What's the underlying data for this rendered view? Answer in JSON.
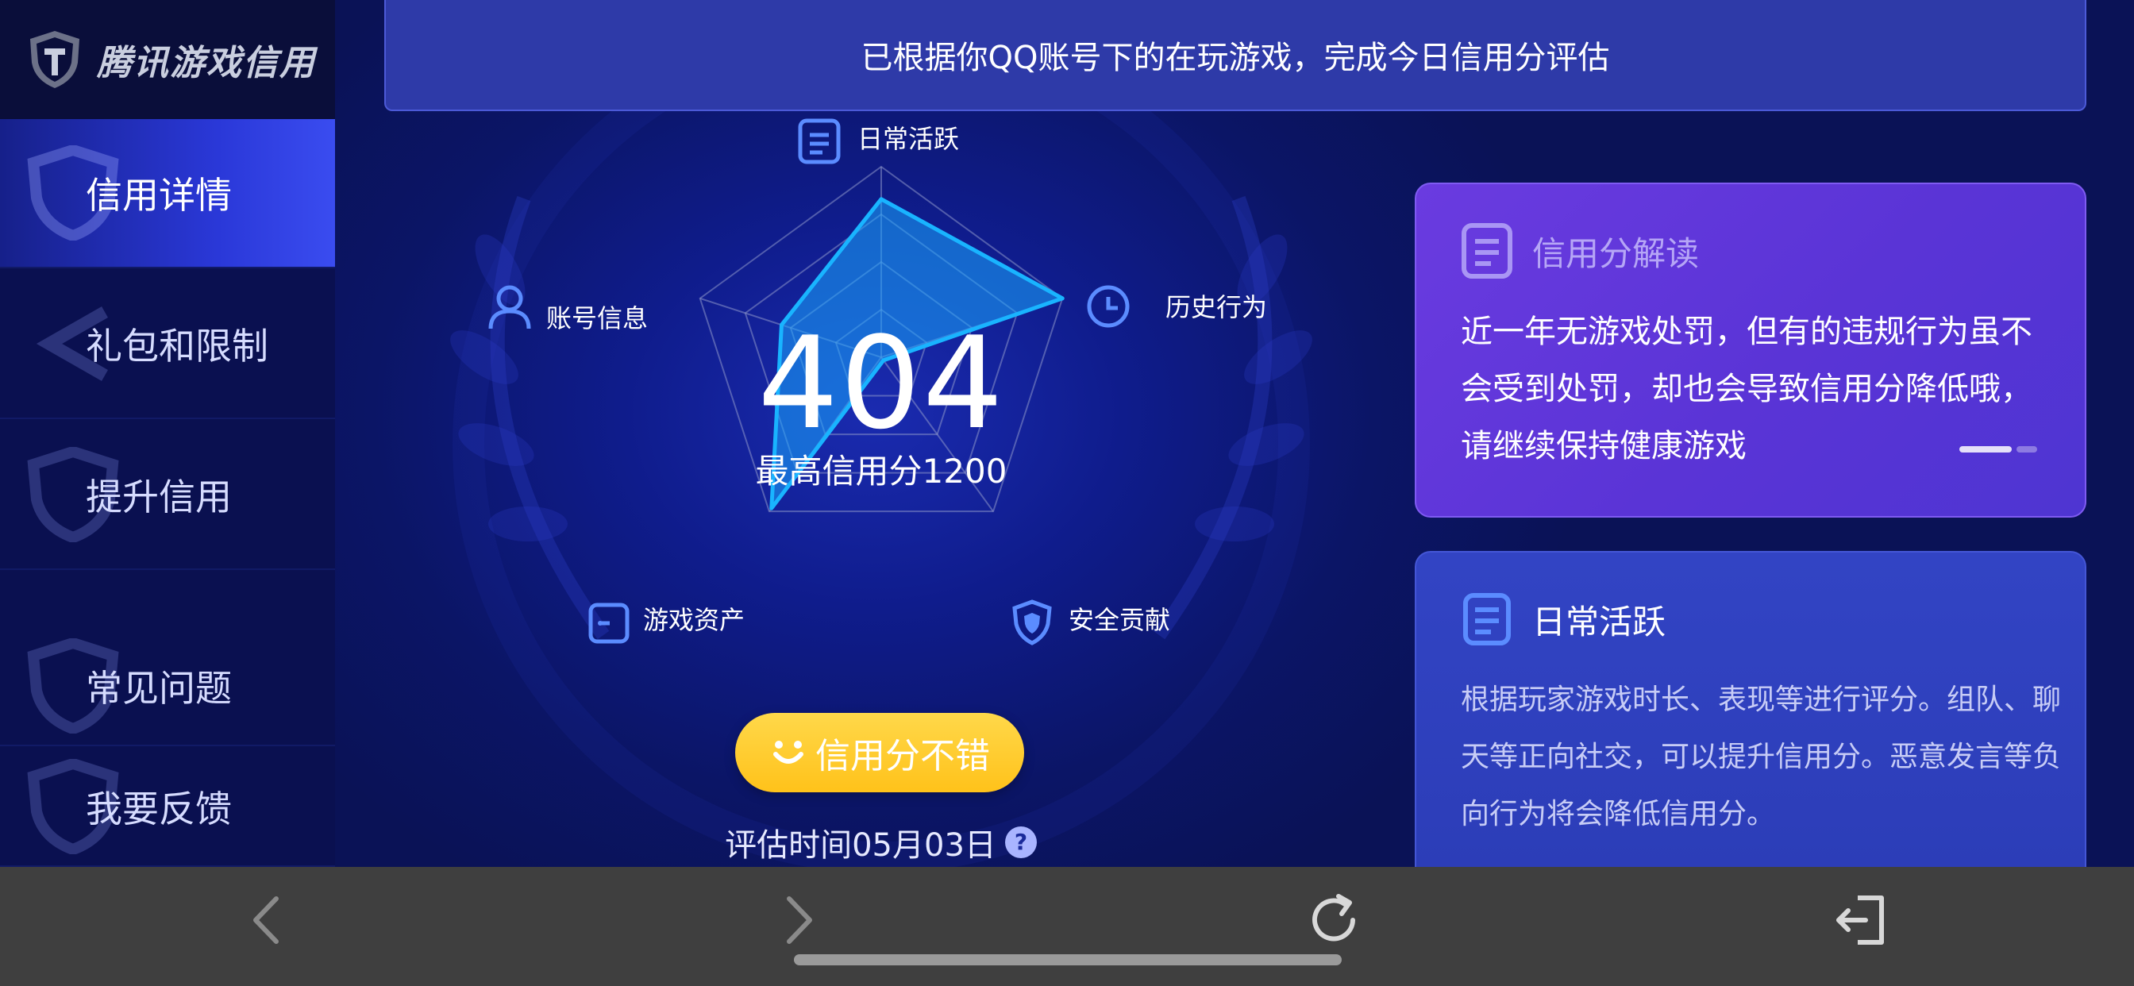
{
  "sidebar": {
    "logo_text": "腾讯游戏信用",
    "items": [
      {
        "label": "信用详情",
        "active": true
      },
      {
        "label": "礼包和限制",
        "active": false
      },
      {
        "label": "提升信用",
        "active": false
      },
      {
        "label": "常见问题",
        "active": false
      },
      {
        "label": "我要反馈",
        "active": false
      }
    ]
  },
  "banner": {
    "text": "已根据你QQ账号下的在玩游戏，完成今日信用分评估"
  },
  "radar": {
    "labels": {
      "daily": "日常活跃",
      "history": "历史行为",
      "security": "安全贡献",
      "assets": "游戏资产",
      "account": "账号信息"
    },
    "levels": {
      "daily": 0.83,
      "history": 1.0,
      "security": 0.02,
      "assets": 0.98,
      "account": 0.55
    }
  },
  "score": {
    "value": "404",
    "max_text": "最高信用分1200"
  },
  "status_pill": {
    "label": "信用分不错"
  },
  "eval_time": {
    "text": "评估时间05月03日"
  },
  "cards": {
    "interpret": {
      "title": "信用分解读",
      "body": "近一年无游戏处罚，但有的违规行为虽不会受到处罚，却也会导致信用分降低哦，请继续保持健康游戏"
    },
    "daily": {
      "title": "日常活跃",
      "body": "根据玩家游戏时长、表现等进行评分。组队、聊天等正向社交，可以提升信用分。恶意发言等负向行为将会降低信用分。"
    }
  },
  "colors": {
    "accent_cyan": "#1ab2ff",
    "pill_yellow": "#ffcb2b",
    "card_purple": "#5a34d6",
    "card_blue": "#2f40bd"
  },
  "icons": {
    "nav": [
      "back-arrow-icon",
      "forward-arrow-icon",
      "refresh-icon",
      "exit-icon"
    ]
  }
}
